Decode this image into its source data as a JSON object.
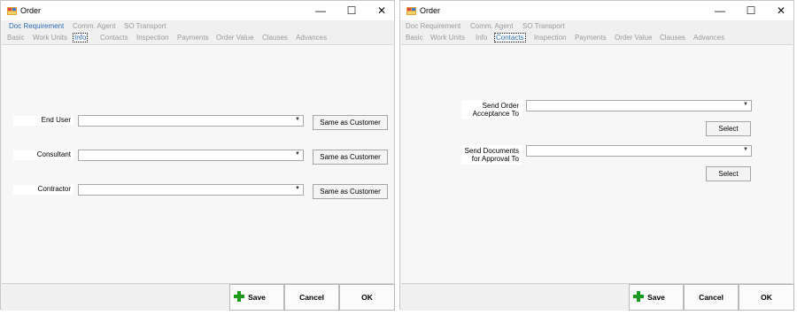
{
  "left": {
    "title": "Order",
    "controls": {
      "minimize": "—",
      "maximize": "☐",
      "close": "✕"
    },
    "tabs_row1": [
      "Doc Requirement",
      "Comm. Agent",
      "SO Transport"
    ],
    "tabs_row2": [
      "Basic",
      "Work Units",
      "Info",
      "Contacts",
      "Inspection",
      "Payments",
      "Order Value",
      "Clauses",
      "Advances"
    ],
    "active_tab": "Info",
    "fields": [
      {
        "label": "End User",
        "value": "",
        "button": "Same as Customer"
      },
      {
        "label": "Consultant",
        "value": "",
        "button": "Same as Customer"
      },
      {
        "label": "Contractor",
        "value": "",
        "button": "Same as Customer"
      }
    ],
    "footer": {
      "save": "Save",
      "cancel": "Cancel",
      "ok": "OK"
    }
  },
  "right": {
    "title": "Order",
    "controls": {
      "minimize": "—",
      "maximize": "☐",
      "close": "✕"
    },
    "tabs_row1": [
      "Doc Requirement",
      "Comm. Agent",
      "SO Transport"
    ],
    "tabs_row2": [
      "Basic",
      "Work Units",
      "Info",
      "Contacts",
      "Inspection",
      "Payments",
      "Order Value",
      "Clauses",
      "Advances"
    ],
    "active_tab": "Contacts",
    "fields": [
      {
        "label_line1": "Send Order",
        "label_line2": "Acceptance To",
        "value": "",
        "button": "Select"
      },
      {
        "label_line1": "Send Documents",
        "label_line2": "for Approval To",
        "value": "",
        "button": "Select"
      }
    ],
    "footer": {
      "save": "Save",
      "cancel": "Cancel",
      "ok": "OK"
    }
  },
  "colors": {
    "tab_blue": "#2b6cb8",
    "tab_gray": "#9a9a9a",
    "save_plus": "#1c9a1c"
  },
  "icons": {
    "app": "order-app-icon",
    "save": "plus-icon"
  }
}
